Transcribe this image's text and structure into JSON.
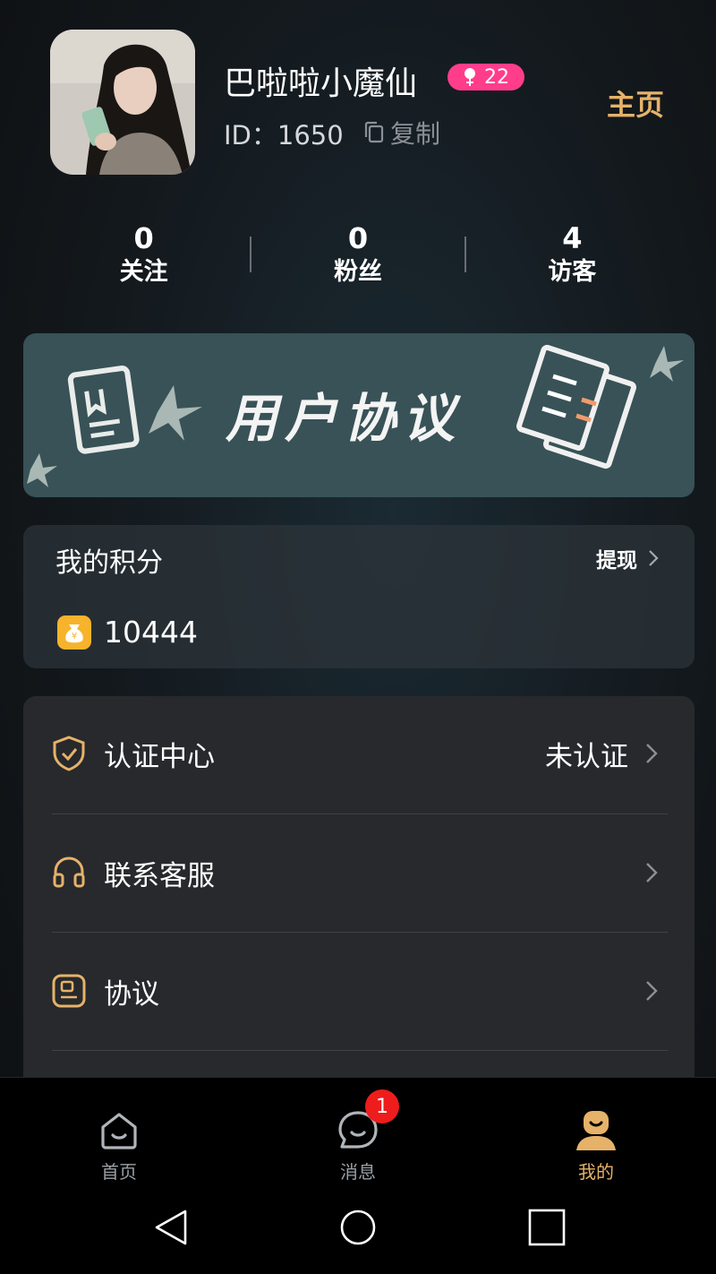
{
  "profile": {
    "username": "巴啦啦小魔仙",
    "age": "22",
    "id_label": "ID：1650",
    "copy_label": "复制",
    "home_label": "主页"
  },
  "stats": [
    {
      "value": "0",
      "label": "关注"
    },
    {
      "value": "0",
      "label": "粉丝"
    },
    {
      "value": "4",
      "label": "访客"
    }
  ],
  "banner": {
    "title": "用户协议"
  },
  "points": {
    "title": "我的积分",
    "withdraw_label": "提现",
    "value": "10444"
  },
  "menu": [
    {
      "label": "认证中心",
      "value": "未认证",
      "icon": "shield-check-icon"
    },
    {
      "label": "联系客服",
      "value": "",
      "icon": "headset-icon"
    },
    {
      "label": "协议",
      "value": "",
      "icon": "document-icon"
    }
  ],
  "nav": {
    "items": [
      {
        "label": "首页",
        "icon": "home-icon"
      },
      {
        "label": "消息",
        "icon": "message-icon"
      },
      {
        "label": "我的",
        "icon": "profile-icon"
      }
    ],
    "message_badge": "1"
  },
  "colors": {
    "accent": "#e6b26a",
    "badge_pink": "#ff3d8b",
    "notification_red": "#ee1c1c",
    "banner_bg": "#385257"
  }
}
